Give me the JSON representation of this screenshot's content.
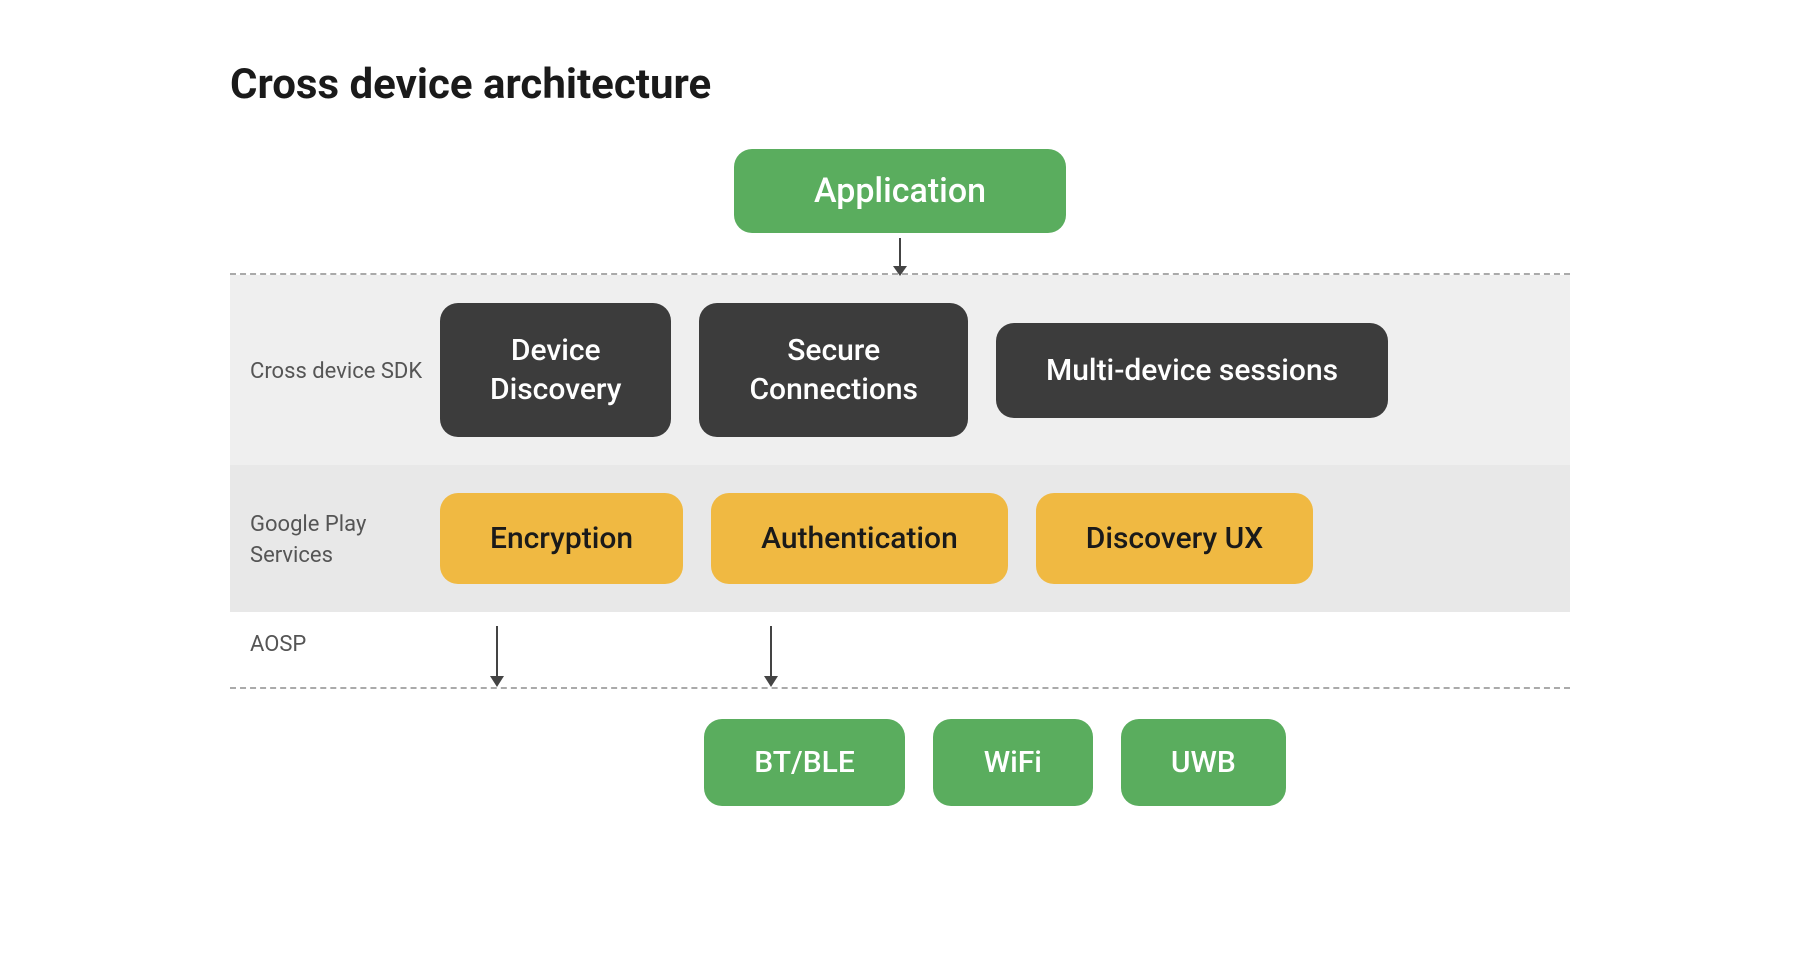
{
  "title": "Cross device architecture",
  "app_box": "Application",
  "sdk_label": "Cross device SDK",
  "sdk_boxes": [
    {
      "label": "Device\nDiscovery",
      "id": "device-discovery"
    },
    {
      "label": "Secure\nConnections",
      "id": "secure-connections"
    },
    {
      "label": "Multi-device sessions",
      "id": "multi-device-sessions"
    }
  ],
  "gps_label": "Google Play\nServices",
  "gps_boxes": [
    {
      "label": "Encryption",
      "id": "encryption"
    },
    {
      "label": "Authentication",
      "id": "authentication"
    },
    {
      "label": "Discovery UX",
      "id": "discovery-ux"
    }
  ],
  "aosp_label": "AOSP",
  "bottom_boxes": [
    {
      "label": "BT/BLE",
      "id": "bt-ble"
    },
    {
      "label": "WiFi",
      "id": "wifi"
    },
    {
      "label": "UWB",
      "id": "uwb"
    }
  ]
}
